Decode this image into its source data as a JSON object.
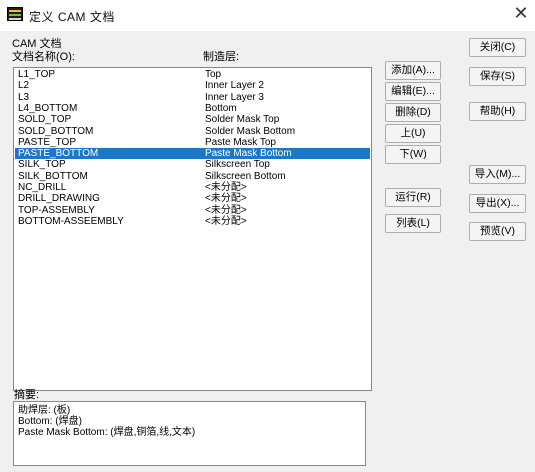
{
  "window": {
    "title": "定义 CAM 文档",
    "app_icon": "cam-app-icon",
    "close_glyph": "✕"
  },
  "group": {
    "title": "CAM 文档",
    "col_doc_name": "文档名称(O):",
    "col_layer": "制造层:"
  },
  "documents": [
    {
      "name": "L1_TOP",
      "layer": "Top",
      "selected": false
    },
    {
      "name": "L2",
      "layer": "Inner Layer 2",
      "selected": false
    },
    {
      "name": "L3",
      "layer": "Inner Layer 3",
      "selected": false
    },
    {
      "name": "L4_BOTTOM",
      "layer": "Bottom",
      "selected": false
    },
    {
      "name": "SOLD_TOP",
      "layer": "Solder Mask Top",
      "selected": false
    },
    {
      "name": "SOLD_BOTTOM",
      "layer": "Solder Mask Bottom",
      "selected": false
    },
    {
      "name": "PASTE_TOP",
      "layer": "Paste Mask Top",
      "selected": false
    },
    {
      "name": "PASTE_BOTTOM",
      "layer": "Paste Mask Bottom",
      "selected": true
    },
    {
      "name": "SILK_TOP",
      "layer": "Silkscreen Top",
      "selected": false
    },
    {
      "name": "SILK_BOTTOM",
      "layer": "Silkscreen Bottom",
      "selected": false
    },
    {
      "name": "NC_DRILL",
      "layer": "<未分配>",
      "selected": false
    },
    {
      "name": "DRILL_DRAWING",
      "layer": "<未分配>",
      "selected": false
    },
    {
      "name": "TOP-ASSEMBLY",
      "layer": "<未分配>",
      "selected": false
    },
    {
      "name": "BOTTOM-ASSEEMBLY",
      "layer": "<未分配>",
      "selected": false
    }
  ],
  "middle_buttons": {
    "add": "添加(A)...",
    "edit": "编辑(E)...",
    "delete": "删除(D)",
    "up": "上(U)",
    "down": "下(W)",
    "run": "运行(R)",
    "list": "列表(L)"
  },
  "right_buttons": {
    "close": "关闭(C)",
    "save": "保存(S)",
    "help": "帮助(H)",
    "import": "导入(M)...",
    "export": "导出(X)...",
    "preview": "预览(V)"
  },
  "summary": {
    "label": "摘要:",
    "lines": [
      "助焊层: (板)",
      "Bottom: (焊盘)",
      "Paste Mask Bottom: (焊盘,铜箔,线,文本)"
    ]
  }
}
